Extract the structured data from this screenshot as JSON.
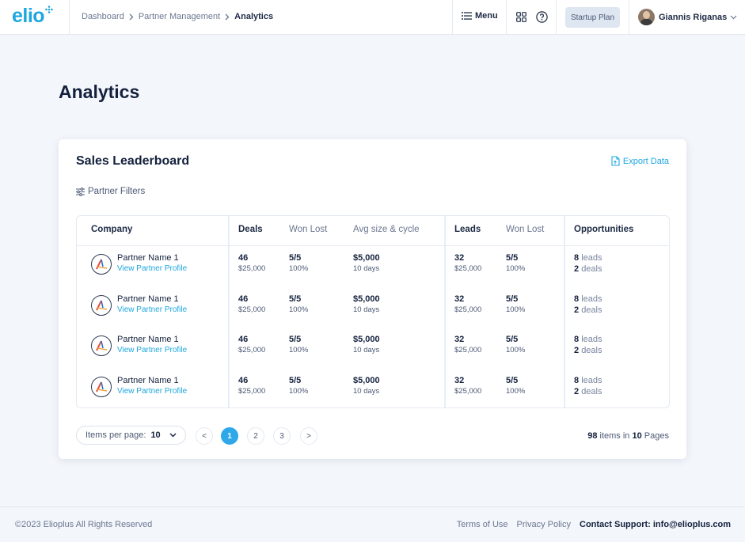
{
  "header": {
    "logo_text": "elio",
    "breadcrumb": [
      "Dashboard",
      "Partner Management",
      "Analytics"
    ],
    "menu_label": "Menu",
    "plan_label": "Startup Plan",
    "user_name": "Giannis Riganas",
    "accent_color": "#1ea7df"
  },
  "page": {
    "title": "Analytics"
  },
  "card": {
    "title": "Sales Leaderboard",
    "export_label": "Export Data",
    "filters_label": "Partner Filters"
  },
  "table": {
    "headers": {
      "company": "Company",
      "deals": "Deals",
      "deals_won_lost": "Won Lost",
      "avg": "Avg size & cycle",
      "leads": "Leads",
      "leads_won_lost": "Won Lost",
      "opportunities": "Opportunities"
    },
    "rows": [
      {
        "name": "Partner Name 1",
        "link": "View Partner Profile",
        "deals": "46",
        "deals_amount": "$25,000",
        "deals_wl": "5/5",
        "deals_wl_pct": "100%",
        "avg_size": "$5,000",
        "avg_cycle": "10 days",
        "leads": "32",
        "leads_amount": "$25,000",
        "leads_wl": "5/5",
        "leads_wl_pct": "100%",
        "opp_leads_num": "8",
        "opp_leads_label": "leads",
        "opp_deals_num": "2",
        "opp_deals_label": "deals"
      },
      {
        "name": "Partner Name 1",
        "link": "View Partner Profile",
        "deals": "46",
        "deals_amount": "$25,000",
        "deals_wl": "5/5",
        "deals_wl_pct": "100%",
        "avg_size": "$5,000",
        "avg_cycle": "10 days",
        "leads": "32",
        "leads_amount": "$25,000",
        "leads_wl": "5/5",
        "leads_wl_pct": "100%",
        "opp_leads_num": "8",
        "opp_leads_label": "leads",
        "opp_deals_num": "2",
        "opp_deals_label": "deals"
      },
      {
        "name": "Partner Name 1",
        "link": "View Partner Profile",
        "deals": "46",
        "deals_amount": "$25,000",
        "deals_wl": "5/5",
        "deals_wl_pct": "100%",
        "avg_size": "$5,000",
        "avg_cycle": "10 days",
        "leads": "32",
        "leads_amount": "$25,000",
        "leads_wl": "5/5",
        "leads_wl_pct": "100%",
        "opp_leads_num": "8",
        "opp_leads_label": "leads",
        "opp_deals_num": "2",
        "opp_deals_label": "deals"
      },
      {
        "name": "Partner Name 1",
        "link": "View Partner Profile",
        "deals": "46",
        "deals_amount": "$25,000",
        "deals_wl": "5/5",
        "deals_wl_pct": "100%",
        "avg_size": "$5,000",
        "avg_cycle": "10 days",
        "leads": "32",
        "leads_amount": "$25,000",
        "leads_wl": "5/5",
        "leads_wl_pct": "100%",
        "opp_leads_num": "8",
        "opp_leads_label": "leads",
        "opp_deals_num": "2",
        "opp_deals_label": "deals"
      }
    ]
  },
  "pagination": {
    "per_page_label": "Items per page:",
    "per_page_value": "10",
    "prev": "<",
    "pages": [
      "1",
      "2",
      "3"
    ],
    "active_page": "1",
    "next": ">",
    "total_items": "98",
    "items_text": "items in",
    "total_pages": "10",
    "pages_text": "Pages"
  },
  "footer": {
    "copyright": "©2023 Elioplus All Rights Reserved",
    "terms": "Terms of Use",
    "privacy": "Privacy Policy",
    "support": "Contact Support: info@elioplus.com"
  }
}
